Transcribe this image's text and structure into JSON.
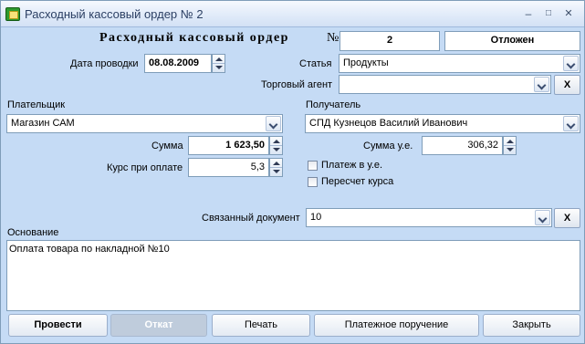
{
  "window": {
    "title": "Расходный кассовый ордер № 2",
    "minimize": "–",
    "maximize": "□",
    "close": "✕"
  },
  "header": {
    "heading": "Расходный кассовый ордер",
    "number_sign": "№",
    "number": "2",
    "status": "Отложен"
  },
  "date": {
    "label": "Дата проводки",
    "value": "08.08.2009"
  },
  "article": {
    "label": "Статья",
    "value": "Продукты"
  },
  "agent": {
    "label": "Торговый агент",
    "value": "",
    "clear": "X"
  },
  "payer": {
    "label": "Плательщик",
    "value": "Магазин САМ"
  },
  "receiver": {
    "label": "Получатель",
    "value": "СПД Кузнецов Василий Иванович"
  },
  "sum": {
    "label": "Сумма",
    "value": "1 623,50"
  },
  "sum_ue": {
    "label": "Сумма у.е.",
    "value": "306,32"
  },
  "rate": {
    "label": "Курс при оплате",
    "value": "5,3"
  },
  "checkboxes": {
    "pay_ue": {
      "label": "Платеж в у.е.",
      "checked": false
    },
    "recalc": {
      "label": "Пересчет курса",
      "checked": false
    }
  },
  "linked_doc": {
    "label": "Связанный документ",
    "value": "10",
    "clear": "X"
  },
  "basis": {
    "label": "Основание",
    "text": "Оплата товара по накладной №10"
  },
  "buttons": {
    "post": "Провести",
    "cancel": "Откат",
    "print": "Печать",
    "payment_order": "Платежное поручение",
    "close": "Закрыть"
  }
}
